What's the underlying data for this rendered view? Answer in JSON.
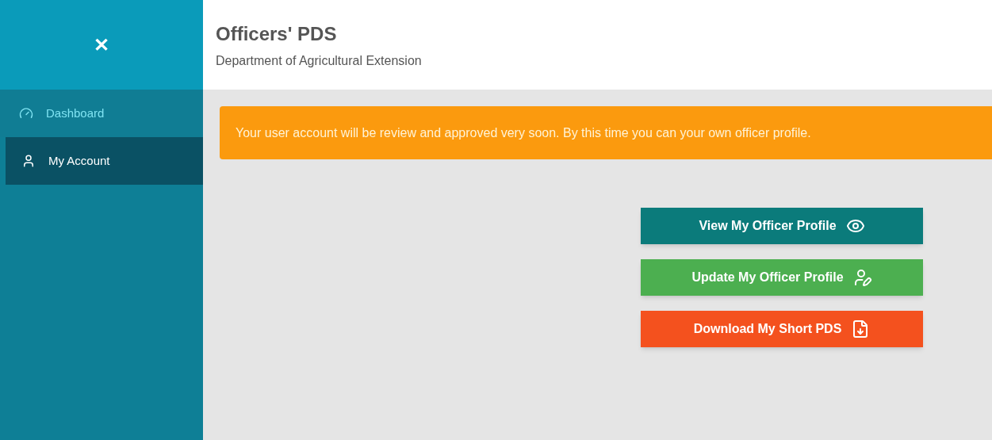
{
  "sidebar": {
    "close_icon": "✕",
    "items": [
      {
        "label": "Dashboard",
        "kind": "dashboard",
        "selected": false
      },
      {
        "label": "My Account",
        "kind": "account",
        "selected": true
      }
    ]
  },
  "header": {
    "title": "Officers' PDS",
    "subtitle": "Department of Agricultural Extension"
  },
  "alert": {
    "text": "Your user account will be review and approved very soon. By this time you can your own officer profile."
  },
  "buttons": [
    {
      "label": "View My Officer Profile",
      "kind": "view"
    },
    {
      "label": "Update My Officer Profile",
      "kind": "update"
    },
    {
      "label": "Download My Short PDS",
      "kind": "download"
    }
  ]
}
